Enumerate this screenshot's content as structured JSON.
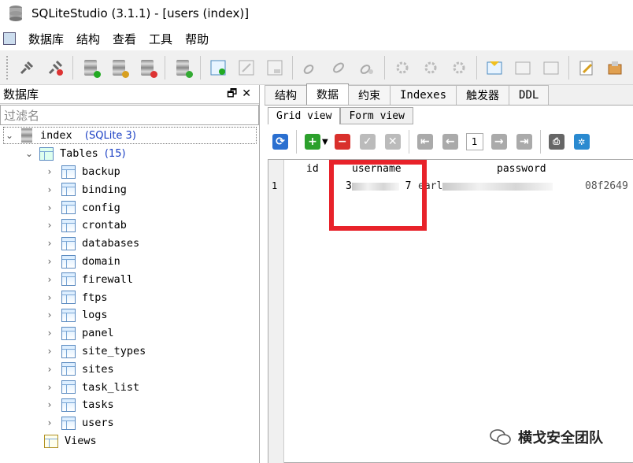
{
  "window": {
    "title": "SQLiteStudio (3.1.1) - [users (index)]"
  },
  "menu": [
    "数据库",
    "结构",
    "查看",
    "工具",
    "帮助"
  ],
  "left_panel": {
    "title": "数据库",
    "filter_placeholder": "过滤名"
  },
  "tree": {
    "db_name": "index",
    "db_type": "(SQLite 3)",
    "tables_label": "Tables",
    "tables_count": "(15)",
    "tables": [
      "backup",
      "binding",
      "config",
      "crontab",
      "databases",
      "domain",
      "firewall",
      "ftps",
      "logs",
      "panel",
      "site_types",
      "sites",
      "task_list",
      "tasks",
      "users"
    ],
    "views_label": "Views"
  },
  "tabs": [
    "结构",
    "数据",
    "约束",
    "Indexes",
    "触发器",
    "DDL"
  ],
  "active_tab": "数据",
  "subtabs": [
    "Grid view",
    "Form view"
  ],
  "pager": {
    "page": "1"
  },
  "grid": {
    "columns": [
      "id",
      "username",
      "password"
    ],
    "row": {
      "num": "1",
      "username_partial": "3",
      "username_tail": "7",
      "password_partial": "earl",
      "password_tail": "08f2649"
    }
  },
  "watermark": "横戈安全团队",
  "colors": {
    "highlight_box": "#e8222a",
    "accent_blue": "#1a3fc4"
  }
}
